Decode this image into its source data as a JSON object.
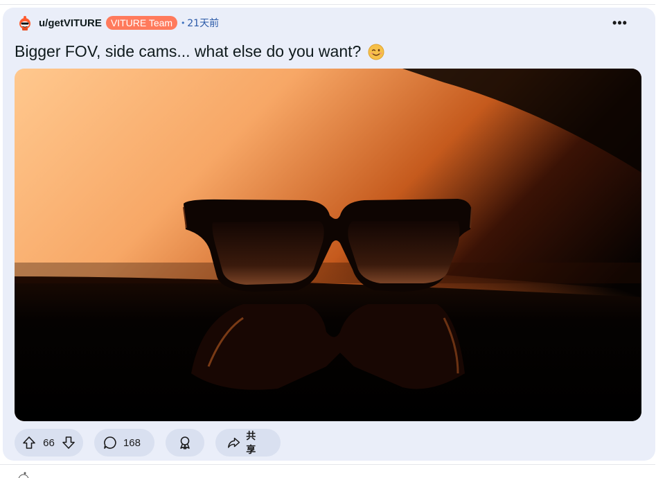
{
  "post": {
    "username": "u/getVITURE",
    "flair": "VITURE Team",
    "separator": "•",
    "timestamp": "21天前",
    "more_label": "•••",
    "title": "Bigger FOV, side cams... what else do you want?",
    "title_emoji": "winking-smile-emoji",
    "image_icon": "sunglasses-photo"
  },
  "actions": {
    "votes": "66",
    "comments": "168",
    "share_label": "共享",
    "upvote_icon": "upvote-arrow-icon",
    "downvote_icon": "downvote-arrow-icon",
    "comment_icon": "comment-bubble-icon",
    "award_icon": "award-icon",
    "share_icon": "share-arrow-icon"
  },
  "colors": {
    "card_bg": "#eaeef9",
    "pill_bg": "#d9e0f0",
    "flair_bg": "#ff7a5c",
    "timestamp": "#2b5aa8"
  }
}
